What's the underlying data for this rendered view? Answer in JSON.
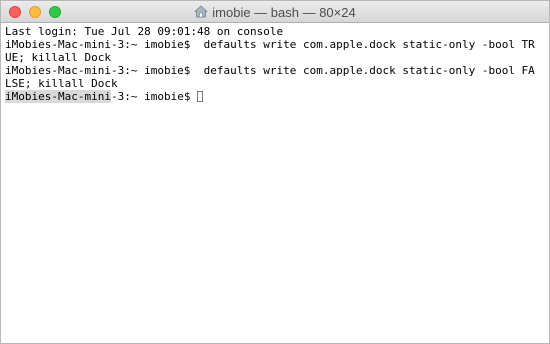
{
  "window": {
    "title": "imobie — bash — 80×24",
    "title_icon": "home-folder-icon"
  },
  "terminal": {
    "lines": [
      "Last login: Tue Jul 28 09:01:48 on console",
      "iMobies-Mac-mini-3:~ imobie$  defaults write com.apple.dock static-only -bool TR",
      "UE; killall Dock",
      "iMobies-Mac-mini-3:~ imobie$  defaults write com.apple.dock static-only -bool FA",
      "LSE; killall Dock"
    ],
    "prompt": {
      "highlighted": "iMobies-Mac-mini",
      "rest": "-3:~ imobie$ "
    }
  },
  "colors": {
    "close": "#fc605c",
    "minimize": "#fdbc40",
    "zoom": "#34c84a"
  }
}
